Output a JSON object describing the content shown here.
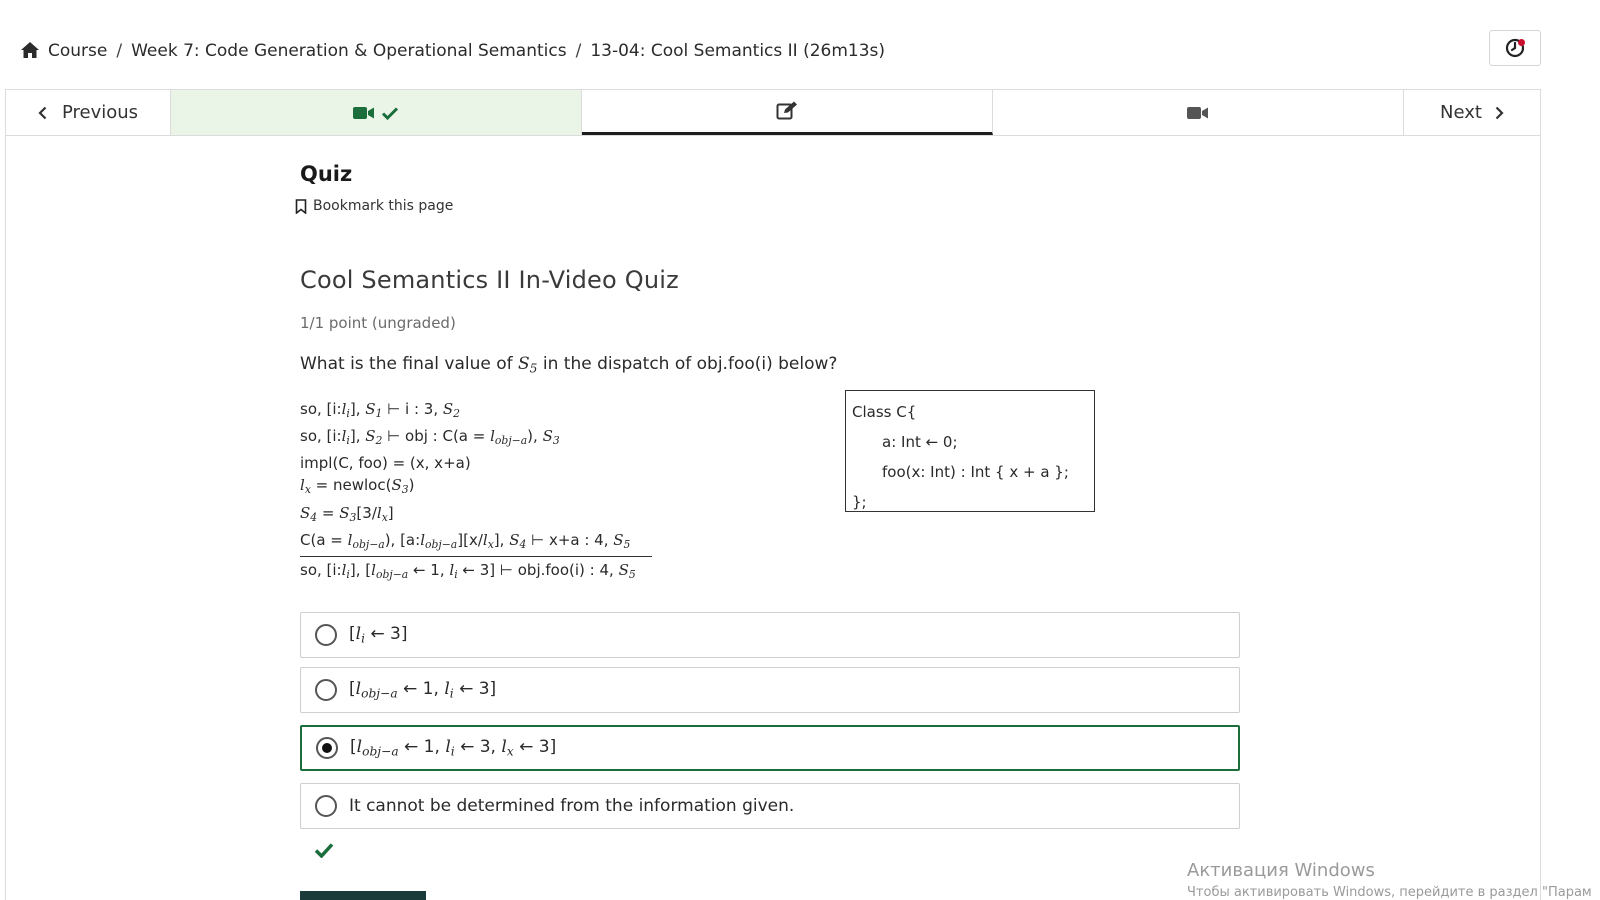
{
  "breadcrumb": {
    "home_icon": "home-icon",
    "items": [
      "Course",
      "Week 7: Code Generation & Operational Semantics",
      "13-04: Cool Semantics II (26m13s)"
    ],
    "separator": "/"
  },
  "header": {
    "notifications_icon": "clock-alert-icon",
    "notification_dot_color": "#c8102e"
  },
  "sequence_nav": {
    "previous_label": "Previous",
    "next_label": "Next",
    "tabs": [
      {
        "icon": "video-check-icon",
        "state": "completed"
      },
      {
        "icon": "edit-icon",
        "state": "active"
      },
      {
        "icon": "video-icon",
        "state": "default"
      }
    ]
  },
  "unit": {
    "title": "Quiz",
    "bookmark_label": "Bookmark this page"
  },
  "problem": {
    "title": "Cool Semantics II In-Video Quiz",
    "points": "1/1 point (ungraded)",
    "question_prefix": "What is the final value of",
    "question_var": "S",
    "question_var_sub": "5",
    "question_suffix": "in the dispatch of obj.foo(i) below?"
  },
  "class_box": {
    "lines": [
      "Class C{",
      "a: Int ← 0;",
      "foo(x: Int) : Int { x + a };",
      "};"
    ]
  },
  "choices": [
    {
      "text_plain": "[l_i ← 3]",
      "selected": false
    },
    {
      "text_plain": "[l_obj−a ← 1, l_i ← 3]",
      "selected": false
    },
    {
      "text_plain": "[l_obj−a ← 1, l_i ← 3, l_x ← 3]",
      "selected": true
    },
    {
      "text": "It cannot be determined from the information given.",
      "selected": false
    }
  ],
  "result": {
    "status": "correct",
    "icon": "checkmark-icon",
    "color": "#1b6e3c"
  },
  "watermark": {
    "title": "Активация Windows",
    "subtitle": "Чтобы активировать Windows, перейдите в раздел \"Парам"
  },
  "colors": {
    "accent_green": "#1b6e3c",
    "completed_tab_bg": "#eaf5e7",
    "submit_bg": "#1b3b3a"
  }
}
